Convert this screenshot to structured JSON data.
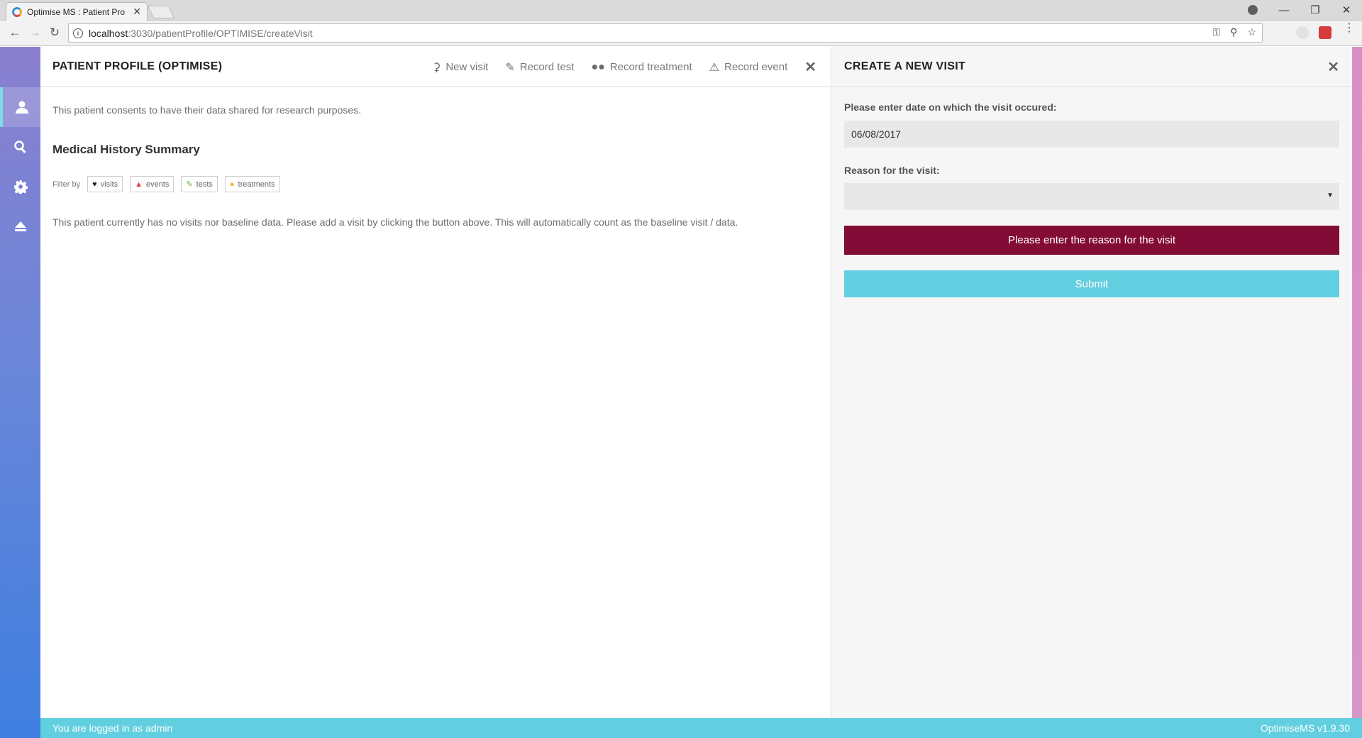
{
  "browser": {
    "tab_title": "Optimise MS : Patient Pro",
    "tab_close": "✕",
    "url_host": "localhost",
    "url_path": ":3030/patientProfile/OPTIMISE/createVisit"
  },
  "left_panel": {
    "title": "PATIENT PROFILE (OPTIMISE)",
    "actions": {
      "new_visit": "New visit",
      "record_test": "Record test",
      "record_treatment": "Record treatment",
      "record_event": "Record event"
    },
    "close": "✕",
    "consent_text": "This patient consents to have their data shared for research purposes.",
    "history_title": "Medical History Summary",
    "filter_label": "Filter by",
    "filters": {
      "visits": "visits",
      "events": "events",
      "tests": "tests",
      "treatments": "treatments"
    },
    "no_visits_text": "This patient currently has no visits nor baseline data. Please add a visit by clicking the button above. This will automatically count as the baseline visit / data."
  },
  "right_panel": {
    "title": "CREATE A NEW VISIT",
    "close": "✕",
    "date_label": "Please enter date on which the visit occured:",
    "date_value": "06/08/2017",
    "reason_label": "Reason for the visit:",
    "reason_value": "",
    "error_message": "Please enter the reason for the visit",
    "submit_label": "Submit"
  },
  "statusbar": {
    "login_text": "You are logged in as admin",
    "version": "OptimiseMS v1.9.30"
  },
  "colors": {
    "error_bg": "#820c35",
    "accent": "#62cfe0",
    "sidebar_top": "#8b7fcf",
    "sidebar_bottom": "#3f7fe0"
  }
}
